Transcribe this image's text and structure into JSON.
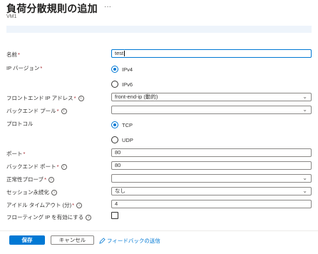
{
  "header": {
    "title": "負荷分散規則の追加",
    "more": "···",
    "subtitle": "VM1"
  },
  "form": {
    "name": {
      "label": "名前",
      "required": "*",
      "value": "test"
    },
    "ip_version": {
      "label": "IP バージョン",
      "required": "*",
      "options": [
        {
          "label": "IPv4",
          "selected": true
        },
        {
          "label": "IPv6",
          "selected": false
        }
      ]
    },
    "frontend_ip": {
      "label": "フロントエンド IP アドレス",
      "required": "*",
      "value": "front-end-ip (動的)"
    },
    "backend_pool": {
      "label": "バックエンド プール",
      "required": "*",
      "value": ""
    },
    "protocol": {
      "label": "プロトコル",
      "options": [
        {
          "label": "TCP",
          "selected": true
        },
        {
          "label": "UDP",
          "selected": false
        }
      ]
    },
    "port": {
      "label": "ポート",
      "required": "*",
      "value": "80"
    },
    "backend_port": {
      "label": "バックエンド ポート",
      "required": "*",
      "value": "80"
    },
    "health_probe": {
      "label": "正常性プローブ",
      "required": "*",
      "value": ""
    },
    "session_persistence": {
      "label": "セッション永続化",
      "value": "なし"
    },
    "idle_timeout": {
      "label": "アイドル タイムアウト (分)",
      "required": "*",
      "value": "4"
    },
    "floating_ip": {
      "label": "フローティング IP を有効にする",
      "checked": false
    }
  },
  "footer": {
    "save_label": "保存",
    "cancel_label": "キャンセル",
    "feedback_label": "フィードバックの送信"
  },
  "colors": {
    "accent": "#0078d4",
    "required": "#a4262c"
  }
}
